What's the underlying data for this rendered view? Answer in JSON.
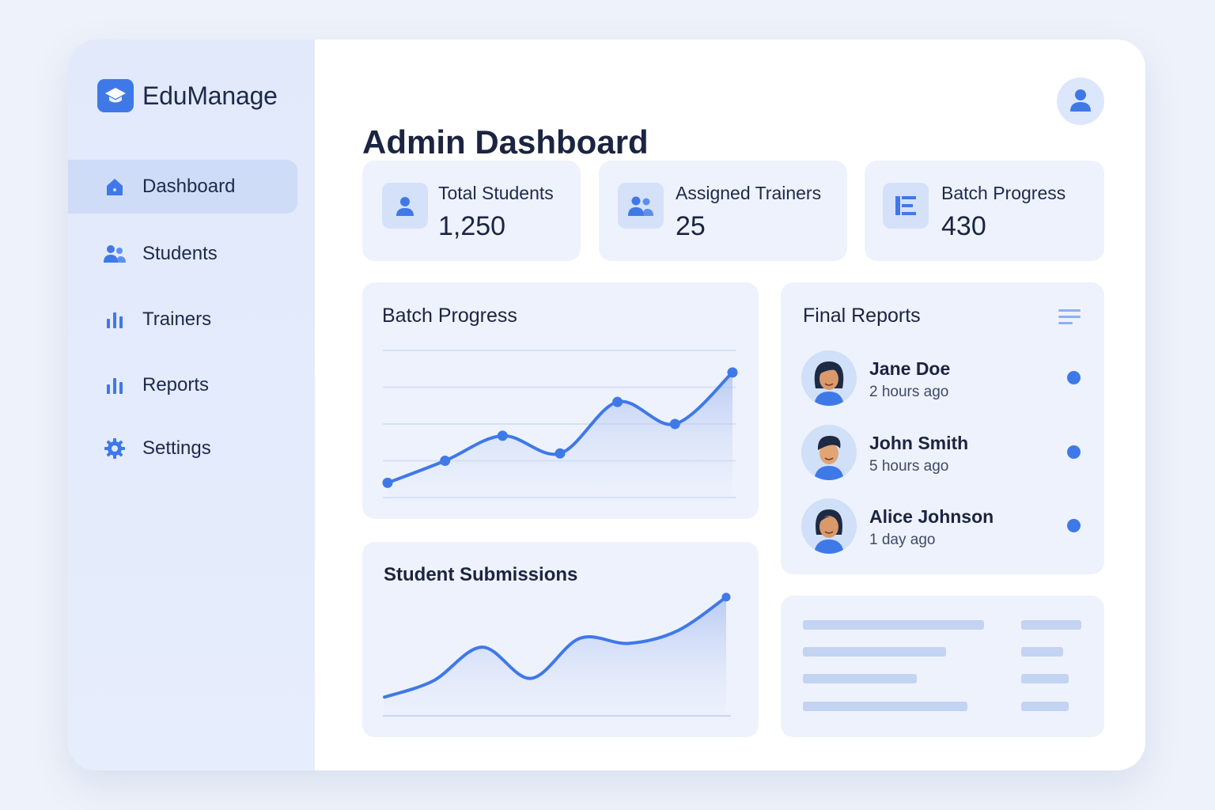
{
  "app": {
    "name": "EduManage"
  },
  "sidebar": {
    "items": [
      {
        "label": "Dashboard",
        "icon": "home-icon",
        "active": true
      },
      {
        "label": "Students",
        "icon": "users-icon",
        "active": false
      },
      {
        "label": "Trainers",
        "icon": "bar-chart-icon",
        "active": false
      },
      {
        "label": "Reports",
        "icon": "bar-chart-icon",
        "active": false
      },
      {
        "label": "Settings",
        "icon": "gear-icon",
        "active": false
      }
    ]
  },
  "header": {
    "title": "Admin Dashboard",
    "avatar_icon": "user-icon"
  },
  "stats": [
    {
      "label": "Total Students",
      "value": "1,250",
      "icon": "user-icon"
    },
    {
      "label": "Assigned Trainers",
      "value": "25",
      "icon": "users-icon"
    },
    {
      "label": "Batch Progress",
      "value": "430",
      "icon": "list-icon"
    }
  ],
  "batch_progress": {
    "title": "Batch Progress"
  },
  "student_submissions": {
    "title": "Student Submissions"
  },
  "final_reports": {
    "title": "Final Reports",
    "menu_icon": "menu-lines-icon",
    "items": [
      {
        "name": "Jane Doe",
        "time": "2 hours ago"
      },
      {
        "name": "John Smith",
        "time": "5 hours ago"
      },
      {
        "name": "Alice Johnson",
        "time": "1 day ago"
      }
    ]
  },
  "colors": {
    "accent": "#3f79e8",
    "sidebar_bg": "#e1e9fb",
    "card_bg": "#eef2fc",
    "text_dark": "#1b2440"
  },
  "chart_data": [
    {
      "type": "line",
      "title": "Batch Progress",
      "xlabel": "",
      "ylabel": "",
      "grid": true,
      "x": [
        1,
        2,
        3,
        4,
        5,
        6,
        7
      ],
      "series": [
        {
          "values": [
            10,
            25,
            42,
            30,
            65,
            50,
            85
          ]
        }
      ],
      "ylim": [
        0,
        100
      ]
    },
    {
      "type": "area",
      "title": "Student Submissions",
      "xlabel": "",
      "ylabel": "",
      "grid": false,
      "x": [
        1,
        2,
        3,
        4,
        5,
        6,
        7,
        8
      ],
      "series": [
        {
          "values": [
            15,
            28,
            55,
            30,
            62,
            58,
            68,
            95
          ]
        }
      ],
      "ylim": [
        0,
        100
      ]
    }
  ]
}
